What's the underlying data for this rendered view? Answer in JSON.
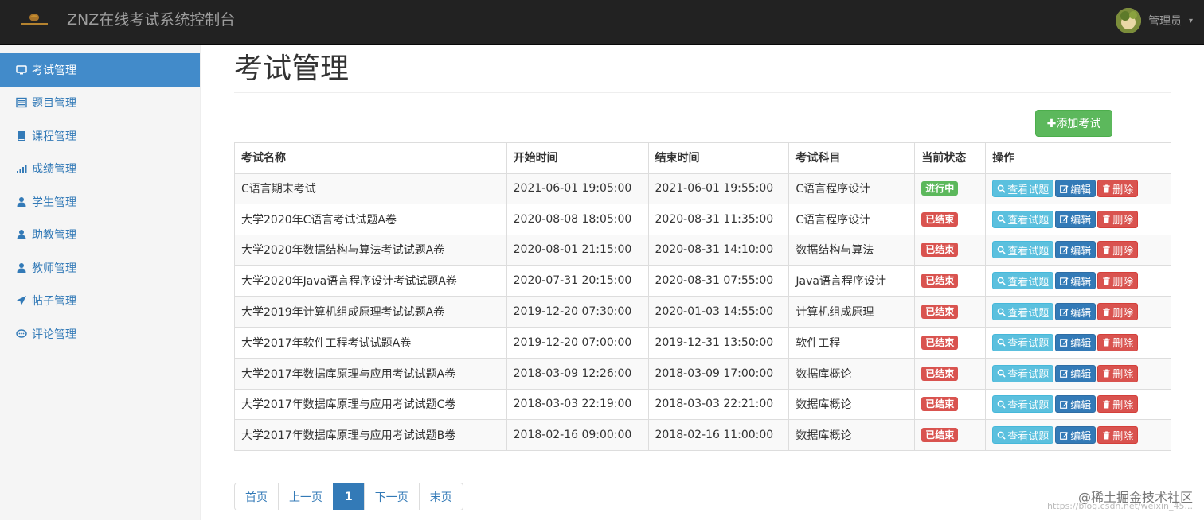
{
  "navbar": {
    "title": "ZNZ在线考试系统控制台",
    "user_label": "管理员",
    "caret": "▾"
  },
  "sidebar": {
    "items": [
      {
        "label": "考试管理",
        "icon": "monitor-icon",
        "active": true
      },
      {
        "label": "题目管理",
        "icon": "list-icon",
        "active": false
      },
      {
        "label": "课程管理",
        "icon": "book-icon",
        "active": false
      },
      {
        "label": "成绩管理",
        "icon": "signal-icon",
        "active": false
      },
      {
        "label": "学生管理",
        "icon": "user-icon",
        "active": false
      },
      {
        "label": "助教管理",
        "icon": "user-icon",
        "active": false
      },
      {
        "label": "教师管理",
        "icon": "user-icon",
        "active": false
      },
      {
        "label": "帖子管理",
        "icon": "send-icon",
        "active": false
      },
      {
        "label": "评论管理",
        "icon": "comment-icon",
        "active": false
      }
    ]
  },
  "main": {
    "title": "考试管理",
    "add_button": "✚添加考试",
    "table": {
      "headers": [
        "考试名称",
        "开始时间",
        "结束时间",
        "考试科目",
        "当前状态",
        "操作"
      ],
      "actions": {
        "view": "查看试题",
        "edit": "编辑",
        "delete": "删除"
      },
      "rows": [
        {
          "name": "C语言期末考试",
          "start": "2021-06-01 19:05:00",
          "end": "2021-06-01 19:55:00",
          "subject": "C语言程序设计",
          "status": "进行中",
          "status_type": "running"
        },
        {
          "name": "大学2020年C语言考试试题A卷",
          "start": "2020-08-08 18:05:00",
          "end": "2020-08-31 11:35:00",
          "subject": "C语言程序设计",
          "status": "已结束",
          "status_type": "ended"
        },
        {
          "name": "大学2020年数据结构与算法考试试题A卷",
          "start": "2020-08-01 21:15:00",
          "end": "2020-08-31 14:10:00",
          "subject": "数据结构与算法",
          "status": "已结束",
          "status_type": "ended"
        },
        {
          "name": "大学2020年Java语言程序设计考试试题A卷",
          "start": "2020-07-31 20:15:00",
          "end": "2020-08-31 07:55:00",
          "subject": "Java语言程序设计",
          "status": "已结束",
          "status_type": "ended"
        },
        {
          "name": "大学2019年计算机组成原理考试试题A卷",
          "start": "2019-12-20 07:30:00",
          "end": "2020-01-03 14:55:00",
          "subject": "计算机组成原理",
          "status": "已结束",
          "status_type": "ended"
        },
        {
          "name": "大学2017年软件工程考试试题A卷",
          "start": "2019-12-20 07:00:00",
          "end": "2019-12-31 13:50:00",
          "subject": "软件工程",
          "status": "已结束",
          "status_type": "ended"
        },
        {
          "name": "大学2017年数据库原理与应用考试试题A卷",
          "start": "2018-03-09 12:26:00",
          "end": "2018-03-09 17:00:00",
          "subject": "数据库概论",
          "status": "已结束",
          "status_type": "ended"
        },
        {
          "name": "大学2017年数据库原理与应用考试试题C卷",
          "start": "2018-03-03 22:19:00",
          "end": "2018-03-03 22:21:00",
          "subject": "数据库概论",
          "status": "已结束",
          "status_type": "ended"
        },
        {
          "name": "大学2017年数据库原理与应用考试试题B卷",
          "start": "2018-02-16 09:00:00",
          "end": "2018-02-16 11:00:00",
          "subject": "数据库概论",
          "status": "已结束",
          "status_type": "ended"
        }
      ]
    },
    "pagination": [
      {
        "label": "首页",
        "active": false
      },
      {
        "label": "上一页",
        "active": false
      },
      {
        "label": "1",
        "active": true
      },
      {
        "label": "下一页",
        "active": false
      },
      {
        "label": "末页",
        "active": false
      }
    ]
  },
  "watermark": {
    "text": "@稀土掘金技术社区",
    "url": "https://blog.csdn.net/weixin_45..."
  },
  "colors": {
    "navbar_bg": "#222222",
    "sidebar_active": "#428bca",
    "link": "#337ab7",
    "success": "#5cb85c",
    "danger": "#d9534f",
    "info": "#5bc0de"
  }
}
